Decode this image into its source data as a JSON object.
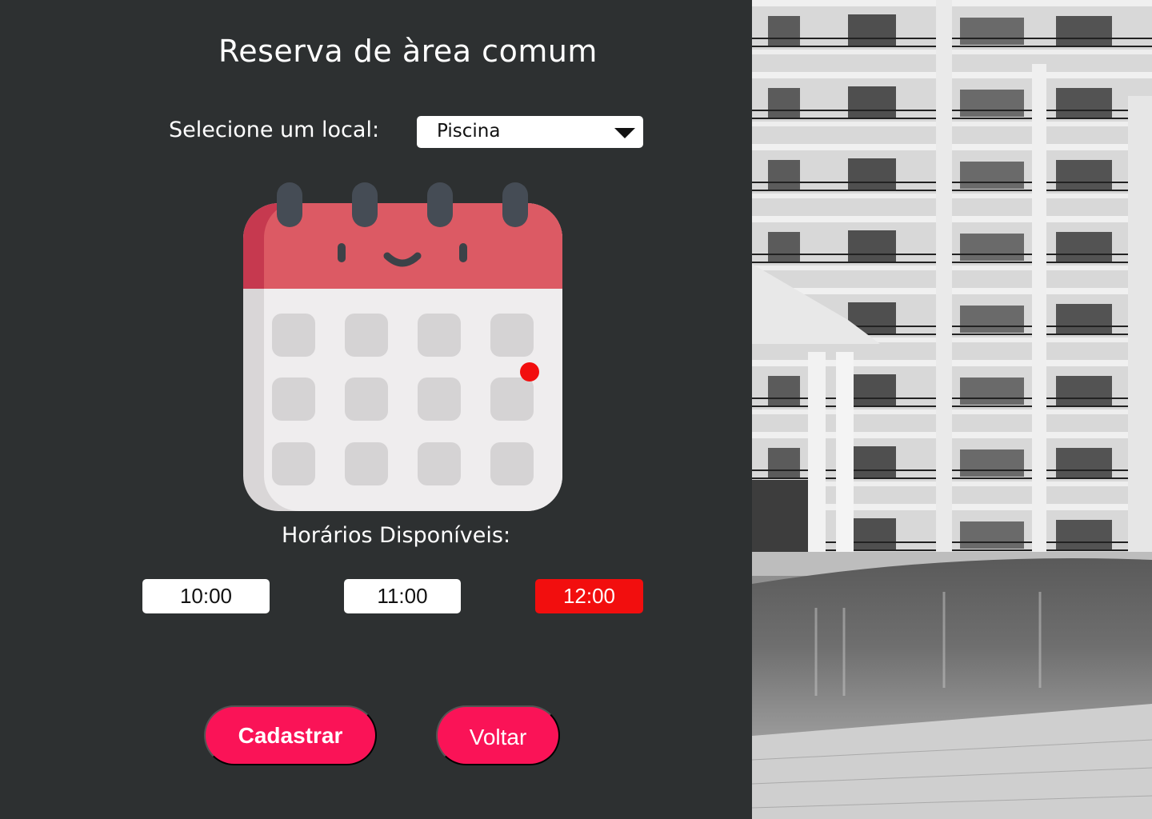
{
  "page": {
    "title": "Reserva de àrea comum"
  },
  "location": {
    "label": "Selecione um local:",
    "selected": "Piscina"
  },
  "calendar": {
    "marked_day_color": "#f20e0e"
  },
  "schedule": {
    "heading": "Horários Disponíveis:",
    "slots": [
      {
        "label": "10:00",
        "selected": false
      },
      {
        "label": "11:00",
        "selected": false
      },
      {
        "label": "12:00",
        "selected": true
      }
    ]
  },
  "actions": {
    "submit_label": "Cadastrar",
    "back_label": "Voltar"
  },
  "colors": {
    "background": "#2d3031",
    "accent": "#fa1357",
    "selected_slot": "#f20e0e"
  }
}
